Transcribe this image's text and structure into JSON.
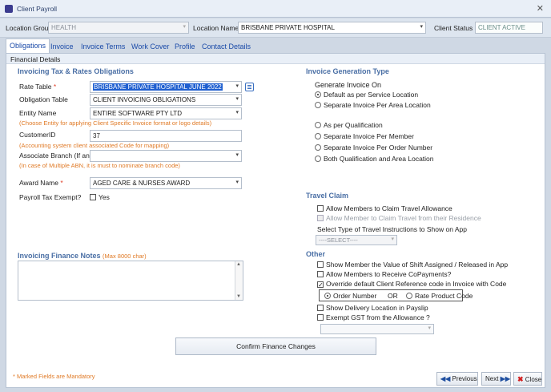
{
  "window": {
    "title": "Client Payroll",
    "close_glyph": "✕"
  },
  "topbar": {
    "location_group_label": "Location Group",
    "location_group_value": "HEALTH",
    "location_name_label": "Location Name",
    "location_name_value": "BRISBANE PRIVATE HOSPITAL",
    "client_status_label": "Client Status",
    "client_status_value": "CLIENT ACTIVE"
  },
  "tabs": [
    "Obligations",
    "Invoice",
    "Invoice Terms",
    "Work Cover",
    "Profile",
    "Contact Details"
  ],
  "section": {
    "title": "Financial Details"
  },
  "left": {
    "heading": "Invoicing Tax & Rates Obligations",
    "rate_table_label": "Rate Table",
    "rate_table_value": "BRISBANE PRIVATE HOSPITAL JUNE 2022",
    "obligation_table_label": "Obligation Table",
    "obligation_table_value": "CLIENT INVOICING OBLIGATIONS",
    "entity_name_label": "Entity Name",
    "entity_name_value": "ENTIRE SOFTWARE PTY LTD",
    "entity_hint": "(Choose Entity for applying Client Specific Invoice format or logo details)",
    "customer_id_label": "CustomerID",
    "customer_id_value": "37",
    "customer_id_hint": "(Accounting system client associated Code for mapping)",
    "associate_branch_label": "Associate Branch (If any)",
    "associate_branch_value": "",
    "associate_branch_hint": "(In case of Multiple ABN, it is must to nominate branch code)",
    "award_name_label": "Award Name",
    "award_name_value": "AGED CARE & NURSES AWARD",
    "payroll_tax_label": "Payroll Tax Exempt?",
    "payroll_tax_option": "Yes",
    "notes_heading": "Invoicing Finance Notes",
    "notes_hint": "(Max 8000 char)",
    "required_star": "*"
  },
  "right": {
    "invoice_gen_heading": "Invoice Generation Type",
    "generate_on_label": "Generate Invoice On",
    "radios": [
      "Default as per Service Location",
      "Separate Invoice Per Area Location",
      "As per Qualification",
      "Separate Invoice Per Member",
      "Separate Invoice Per Order Number",
      "Both Qualification and Area Location"
    ],
    "travel_heading": "Travel Claim",
    "travel_allow": "Allow Members to Claim Travel Allowance",
    "travel_residence": "Allow Member to Claim Travel from their Residence",
    "travel_select_label": "Select Type of Travel Instructions to Show on App",
    "travel_select_value": "----SELECT----",
    "other_heading": "Other",
    "other_show_value": "Show Member the Value of Shift Assigned / Released in App",
    "other_copayments": "Allow Members to Receive CoPayments?",
    "other_override": "Override default Client Reference code in Invoice with Code",
    "order_number": "Order Number",
    "or_text": "OR",
    "rate_product_code": "Rate Product Code",
    "show_delivery": "Show Delivery Location in Payslip",
    "exempt_gst": "Exempt GST from the Allowance ?"
  },
  "confirm_button": "Confirm Finance Changes",
  "footer": {
    "mandatory_note": "* Marked Fields are Mandatory",
    "previous": "Previous",
    "next": "Next",
    "close": "Close"
  },
  "glyphs": {
    "dropdown": "▾",
    "prev": "◀◀",
    "next": "▶▶",
    "close_x": "✖",
    "check": "✓",
    "scroll_up": "▲",
    "scroll_down": "▼"
  },
  "colors": {
    "accent_blue": "#4a6fa5",
    "hint_orange": "#e07a26",
    "required_red": "#e0402a",
    "selection_blue": "#1f5fd0"
  }
}
